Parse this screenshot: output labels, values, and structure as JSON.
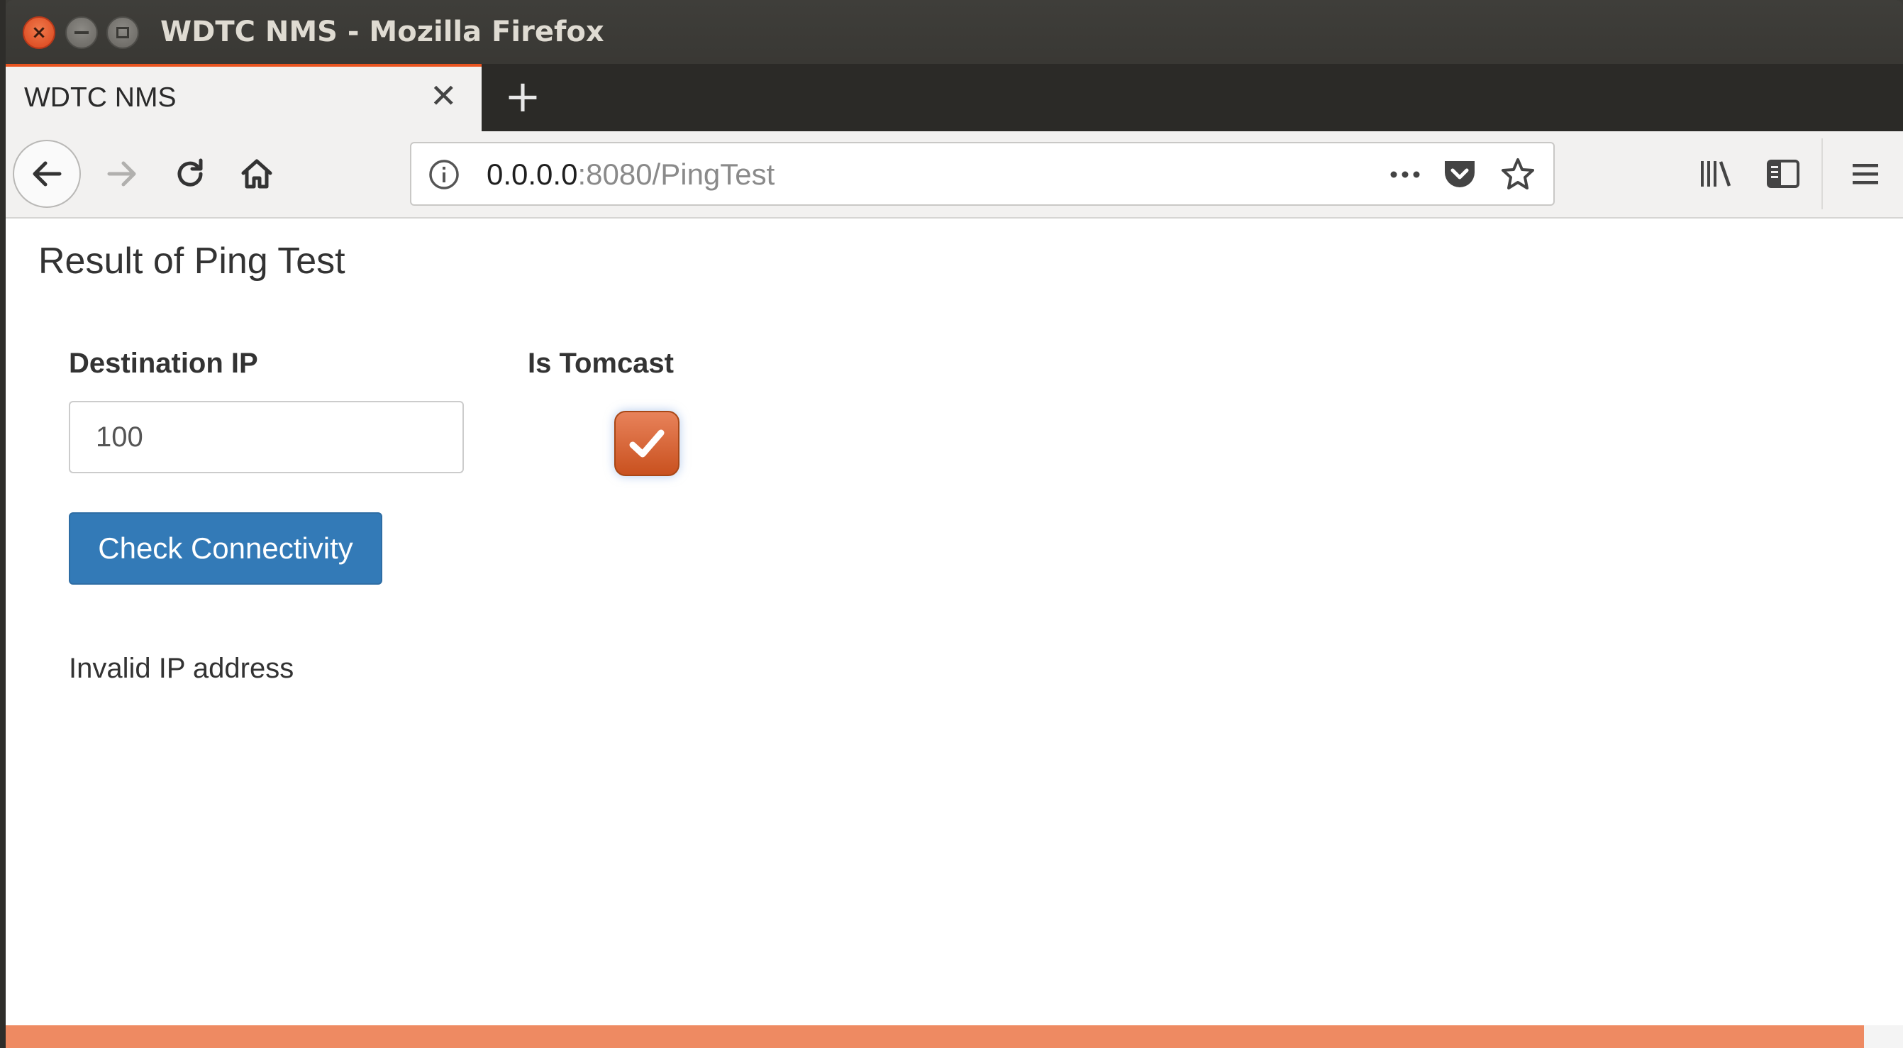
{
  "window": {
    "title": "WDTC NMS - Mozilla Firefox",
    "close_glyph": "×"
  },
  "tabs": [
    {
      "label": "WDTC NMS",
      "active": true
    }
  ],
  "tab_close_glyph": "✕",
  "new_tab_glyph": "+",
  "address_bar": {
    "url_host": "0.0.0.0",
    "url_path": ":8080/PingTest"
  },
  "page": {
    "title": "Result of Ping Test",
    "destination_ip_label": "Destination IP",
    "destination_ip_value": "100",
    "is_tomcast_label": "Is Tomcast",
    "is_tomcast_checked": true,
    "check_button_label": "Check Connectivity",
    "result_message": "Invalid IP address"
  },
  "icons": {
    "back": "back-arrow-icon",
    "forward": "forward-arrow-icon",
    "reload": "reload-icon",
    "home": "home-icon",
    "info": "info-icon",
    "page_actions": "more-actions-icon",
    "pocket": "pocket-icon",
    "bookmark": "bookmark-star-icon",
    "library": "library-icon",
    "sidebar": "sidebar-icon",
    "menu": "hamburger-menu-icon"
  },
  "colors": {
    "accent": "#e95420",
    "button_primary": "#337ab7",
    "checkbox": "#d8612f"
  }
}
